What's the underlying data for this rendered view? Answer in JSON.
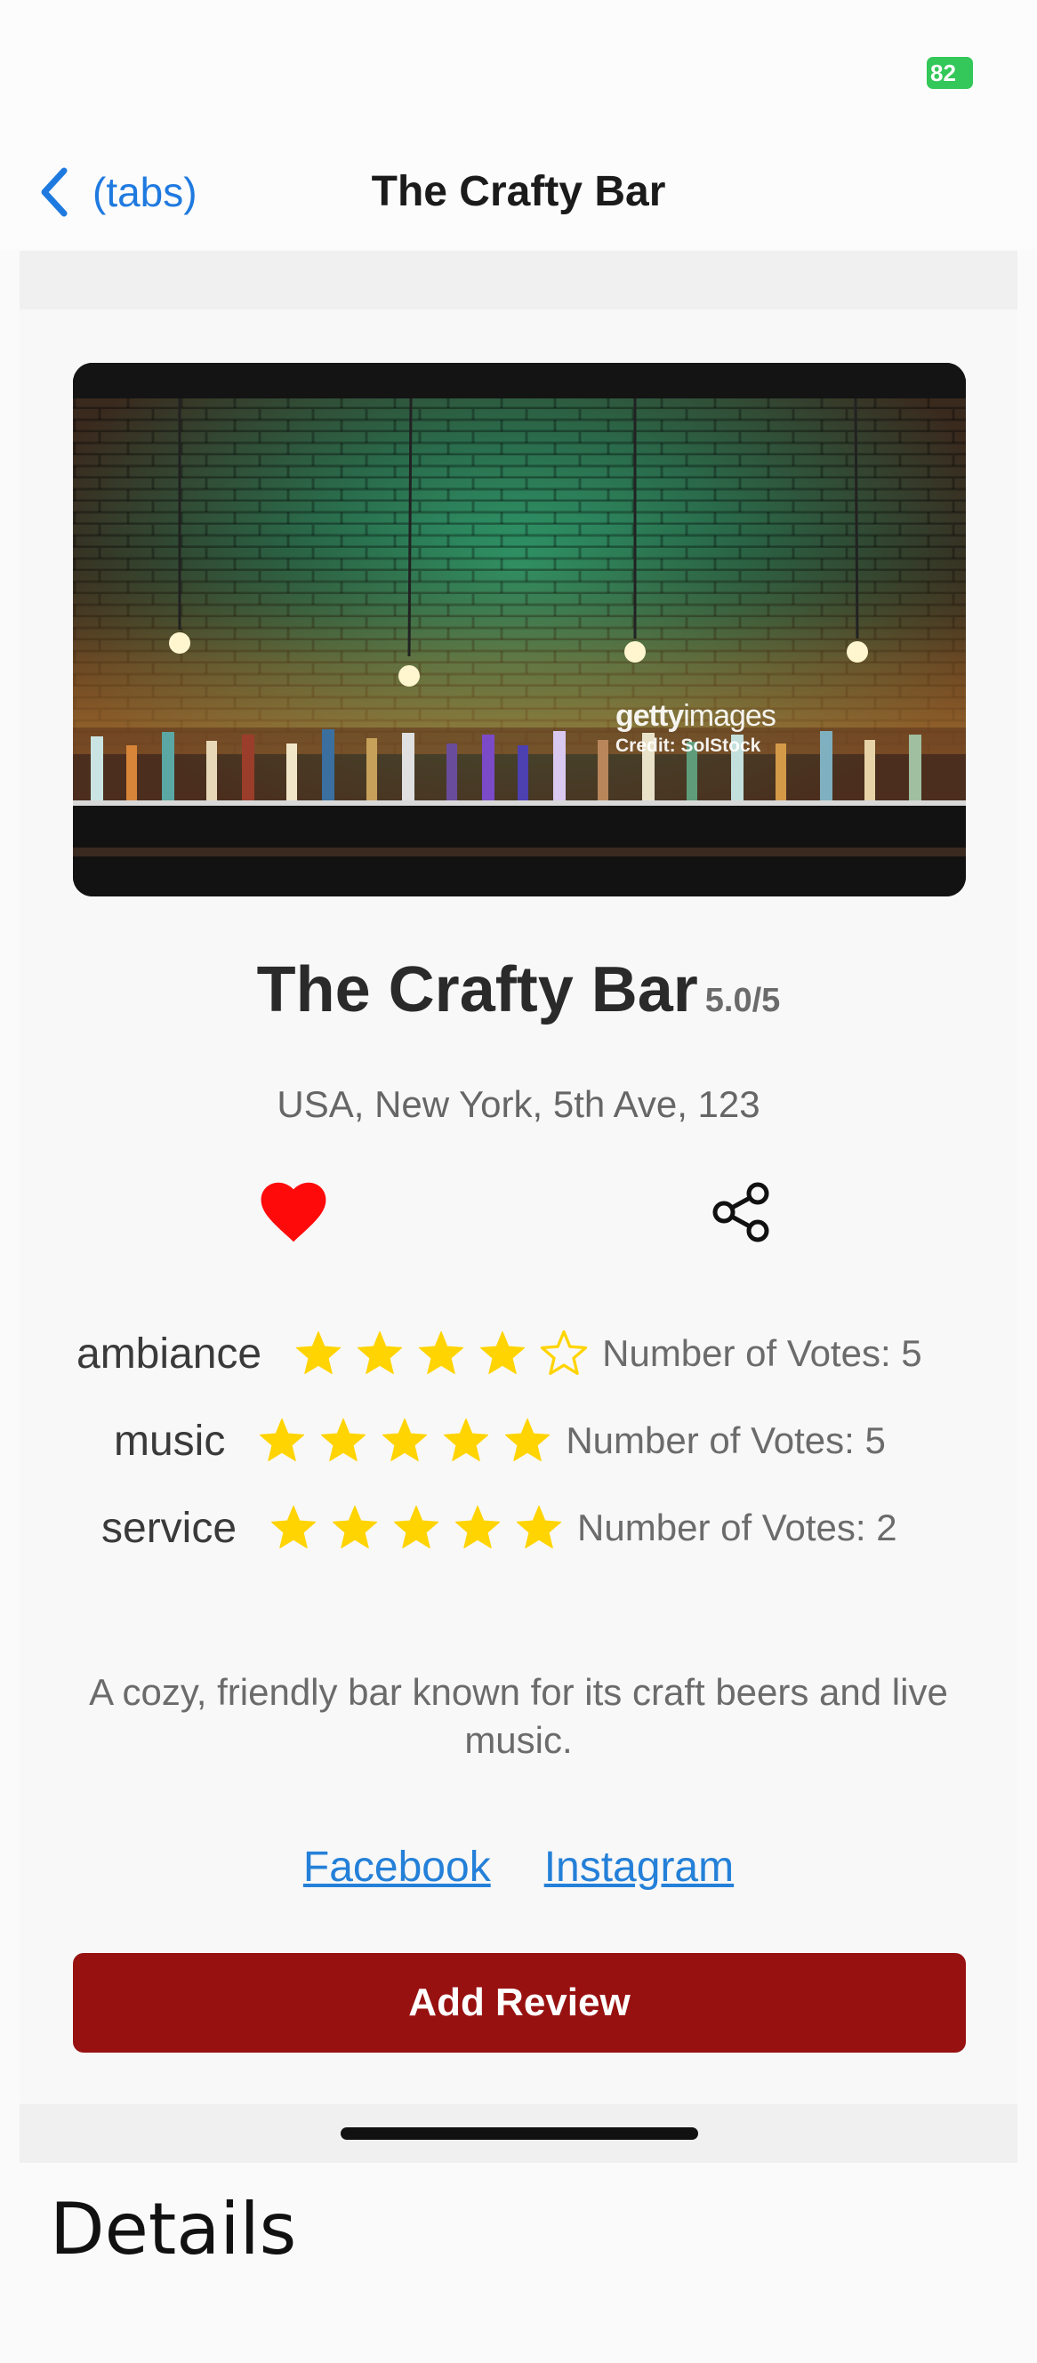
{
  "status_bar": {
    "battery": "82"
  },
  "nav": {
    "back_label": "(tabs)",
    "title": "The Crafty Bar"
  },
  "hero_image": {
    "watermark_logo_bold": "getty",
    "watermark_logo_light": "images",
    "watermark_credit": "Credit: SolStock"
  },
  "place": {
    "name": "The Crafty Bar",
    "score": "5.0/5",
    "address": "USA, New York, 5th Ave, 123",
    "favorited": true
  },
  "ratings": [
    {
      "label": "ambiance",
      "stars": 4,
      "max_stars": 5,
      "votes": "Number of Votes: 5"
    },
    {
      "label": "music",
      "stars": 5,
      "max_stars": 5,
      "votes": "Number of Votes: 5"
    },
    {
      "label": "service",
      "stars": 5,
      "max_stars": 5,
      "votes": "Number of Votes: 2"
    }
  ],
  "description": "A cozy, friendly bar known for its craft beers and live music.",
  "links": {
    "facebook": "Facebook",
    "instagram": "Instagram"
  },
  "actions": {
    "add_review": "Add Review"
  },
  "footer": {
    "details": "Details"
  },
  "colors": {
    "accent_blue": "#1f7ae0",
    "heart_red": "#ff0a0a",
    "star_yellow": "#ffd400",
    "button_red": "#981111"
  },
  "icons": {
    "back": "chevron-left-icon",
    "favorite": "heart-icon",
    "share": "share-icon",
    "rating": "star-icon"
  }
}
